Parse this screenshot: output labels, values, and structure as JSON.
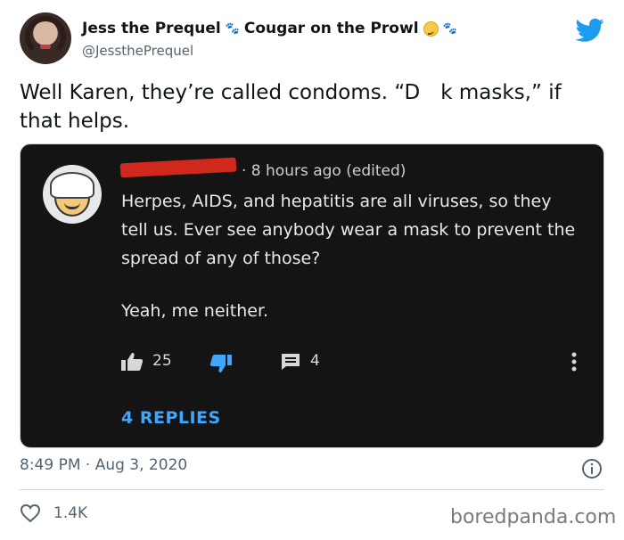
{
  "author": {
    "display_name_part1": "Jess the Prequel",
    "display_name_part2": "Cougar on the Prowl",
    "handle": "@JessthePrequel"
  },
  "tweet": {
    "text_line1": "Well Karen, they’re called condoms. “D k masks,” if",
    "text_line2": "that helps.",
    "timestamp": "8:49 PM · Aug 3, 2020",
    "like_count": "1.4K"
  },
  "embedded_comment": {
    "meta": "· 8 hours ago (edited)",
    "body_line1": "Herpes, AIDS, and hepatitis are all viruses, so they",
    "body_line2": "tell us. Ever see anybody wear a mask to prevent the",
    "body_line3": "spread of any of those?",
    "body_reply": "Yeah, me neither.",
    "likes": "25",
    "comments": "4",
    "replies_label": "4 REPLIES"
  },
  "watermark": "boredpanda.com",
  "colors": {
    "twitter_blue": "#1d9bf0",
    "card_bg": "#141414",
    "replies_blue": "#3ea6ff",
    "redaction": "#d1281c"
  },
  "icons": [
    "twitter-bird-icon",
    "paw-icon",
    "smirk-emoji-icon",
    "thumbs-up-icon",
    "thumbs-down-icon",
    "comment-icon",
    "more-vertical-icon",
    "info-icon",
    "heart-icon"
  ]
}
